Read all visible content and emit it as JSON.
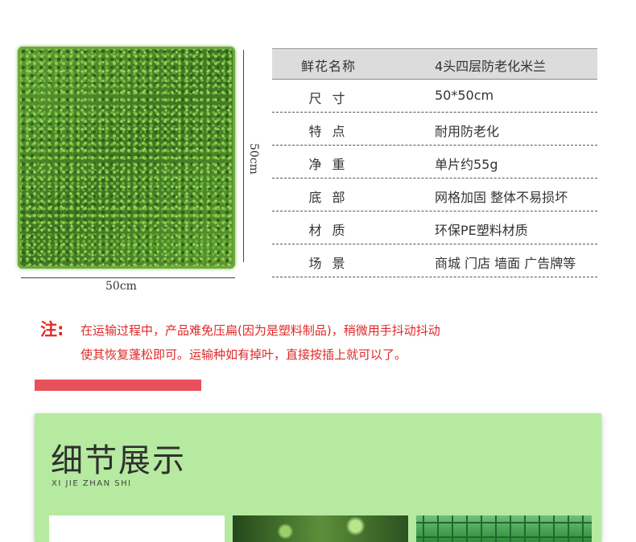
{
  "product_image": {
    "width_label": "50cm",
    "height_label": "50cm"
  },
  "spec": {
    "header": {
      "key": "鲜花名称",
      "value": "4头四层防老化米兰"
    },
    "rows": [
      {
        "key": "尺 寸",
        "value": "50*50cm"
      },
      {
        "key": "特 点",
        "value": "耐用防老化"
      },
      {
        "key": "净 重",
        "value": "单片约55g"
      },
      {
        "key": "底 部",
        "value": "网格加固 整体不易损坏"
      },
      {
        "key": "材 质",
        "value": "环保PE塑料材质"
      },
      {
        "key": "场 景",
        "value": "商城 门店 墙面 广告牌等"
      }
    ]
  },
  "note": {
    "mark": "注:",
    "line1": "在运输过程中，产品难免压扁(因为是塑料制品)，稍微用手抖动抖动",
    "line2": "使其恢复蓬松即可。运输种如有掉叶，直接按插上就可以了。"
  },
  "detail": {
    "title": "细节展示",
    "subtitle": "XI JIE ZHAN SHI"
  },
  "colors": {
    "accent_red": "#e8505a",
    "note_red": "#e02828",
    "detail_bg": "#b6eaa0"
  }
}
